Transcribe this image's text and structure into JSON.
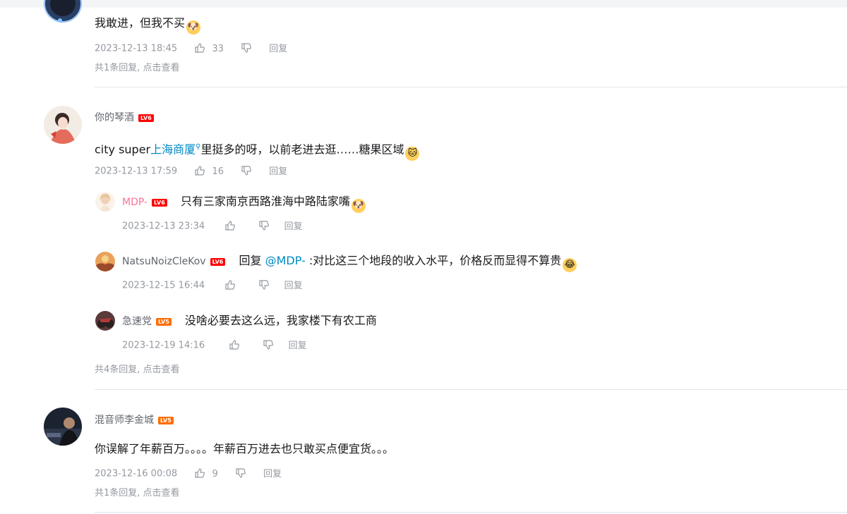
{
  "threads": [
    {
      "content_text": "我敢进，但我不买",
      "content_emoji": "🐶",
      "time": "2023-12-13 18:45",
      "likes": "33",
      "reply_label": "回复",
      "view_replies": "共1条回复, 点击查看"
    },
    {
      "username": "你的琴酒",
      "level": "LV6",
      "content_pre": "city super",
      "content_link": "上海商厦",
      "content_post": "里挺多的呀，以前老进去逛……糖果区域",
      "content_emoji": "🐱",
      "time": "2023-12-13 17:59",
      "likes": "16",
      "reply_label": "回复",
      "replies": [
        {
          "username": "MDP-",
          "level": "LV6",
          "content_text": "只有三家南京西路淮海中路陆家嘴",
          "content_emoji": "🐶",
          "time": "2023-12-13 23:34",
          "reply_label": "回复"
        },
        {
          "username": "NatsuNoizCleKov",
          "level": "LV6",
          "reply_prefix": "回复 ",
          "mention": "@MDP-",
          "content_text": " :对比这三个地段的收入水平，价格反而显得不算贵",
          "content_emoji": "😂",
          "time": "2023-12-15 16:44",
          "reply_label": "回复"
        },
        {
          "username": "急速党",
          "level": "LV5",
          "content_text": "没啥必要去这么远，我家楼下有农工商",
          "time": "2023-12-19 14:16",
          "reply_label": "回复"
        }
      ],
      "view_replies": "共4条回复, 点击查看"
    },
    {
      "username": "混音师李金城",
      "level": "LV5",
      "content_text": "你误解了年薪百万。。。。年薪百万进去也只敢买点便宜货。。。",
      "time": "2023-12-16 00:08",
      "likes": "9",
      "reply_label": "回复",
      "view_replies": "共1条回复, 点击查看"
    }
  ],
  "colors": {
    "link": "#008ac5",
    "meta": "#9499a0",
    "username": "#61666d",
    "vip_pink": "#fb7299",
    "level5": "#ff6c00",
    "level6": "#ff0000"
  },
  "icons": [
    "thumb-up-icon",
    "thumb-down-icon",
    "search-icon"
  ]
}
